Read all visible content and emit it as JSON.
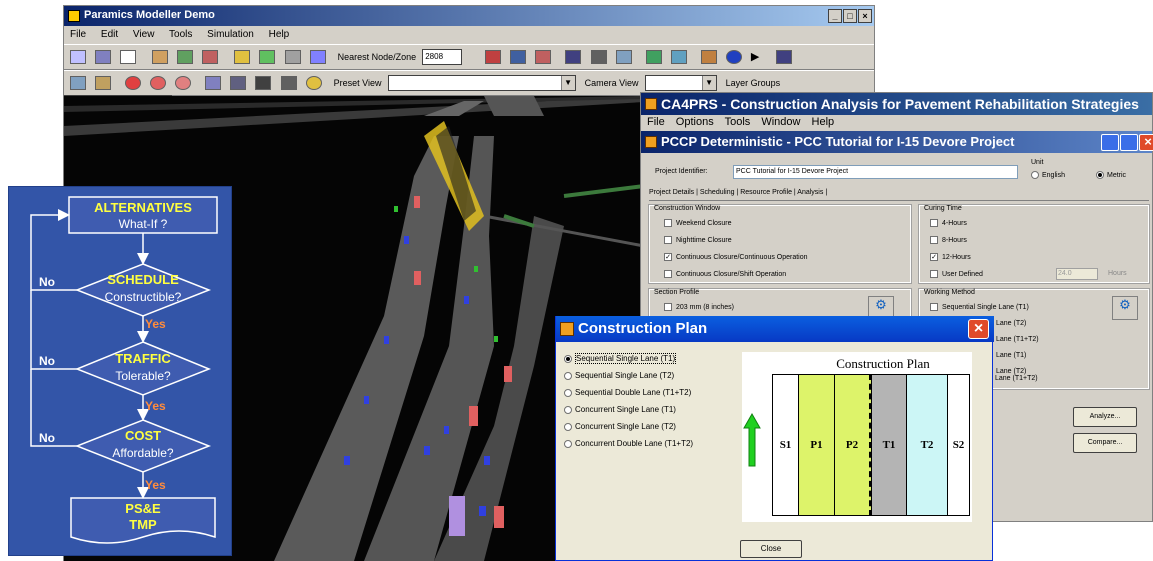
{
  "paramics": {
    "title": "Paramics Modeller Demo",
    "menu": [
      "File",
      "Edit",
      "View",
      "Tools",
      "Simulation",
      "Help"
    ],
    "toolbar": {
      "nearest_node_label": "Nearest Node/Zone",
      "nearest_node_value": "2808",
      "preset_view_label": "Preset View",
      "camera_view_label": "Camera View",
      "layer_groups_label": "Layer Groups"
    }
  },
  "flowchart": {
    "steps": [
      {
        "title": "ALTERNATIVES",
        "subtitle": "What-If ?"
      },
      {
        "title": "SCHEDULE",
        "subtitle": "Constructible?"
      },
      {
        "title": "TRAFFIC",
        "subtitle": "Tolerable?"
      },
      {
        "title": "COST",
        "subtitle": "Affordable?"
      },
      {
        "title": "PS&E",
        "subtitle": "TMP"
      }
    ],
    "no_label": "No",
    "yes_label": "Yes"
  },
  "ca4prs": {
    "title": "CA4PRS - Construction Analysis for Pavement Rehabilitation Strategies",
    "menu": [
      "File",
      "Options",
      "Tools",
      "Window",
      "Help"
    ],
    "child_title": "PCCP Deterministic - PCC Tutorial for I-15 Devore Project",
    "project_identifier_label": "Project Identifier:",
    "project_identifier_value": "PCC Tutorial for I-15 Devore Project",
    "unit_label": "Unit",
    "unit_options": [
      "English",
      "Metric"
    ],
    "unit_selected": "Metric",
    "tabs": [
      "Project Details",
      "Scheduling",
      "Resource Profile",
      "Analysis"
    ],
    "construction_window": {
      "label": "Construction Window",
      "options": [
        {
          "label": "Weekend Closure",
          "checked": false
        },
        {
          "label": "Nighttime Closure",
          "checked": false
        },
        {
          "label": "Continuous Closure/Continuous Operation",
          "checked": true
        },
        {
          "label": "Continuous Closure/Shift Operation",
          "checked": false
        }
      ]
    },
    "curing_time": {
      "label": "Curing Time",
      "options": [
        {
          "label": "4-Hours",
          "checked": false
        },
        {
          "label": "8-Hours",
          "checked": false
        },
        {
          "label": "12-Hours",
          "checked": true
        },
        {
          "label": "User Defined",
          "checked": false
        }
      ],
      "user_value": "24.0",
      "unit": "Hours"
    },
    "section_profile": {
      "label": "Section Profile",
      "option": "203 mm (8 inches)"
    },
    "working_method": {
      "label": "Working Method",
      "options": [
        "Sequential Single Lane (T1)",
        "Lane (T2)",
        "Lane (T1+T2)",
        "Lane (T1)",
        "Lane (T2)",
        "Lane (T1+T2)"
      ]
    },
    "buttons": {
      "analyze": "Analyze...",
      "compare": "Compare..."
    }
  },
  "construction_plan": {
    "title": "Construction Plan",
    "options": [
      "Sequential Single Lane (T1)",
      "Sequential Single Lane (T2)",
      "Sequential  Double Lane (T1+T2)",
      "Concurrent Single Lane (T1)",
      "Concurrent Single Lane (T2)",
      "Concurrent Double Lane (T1+T2)"
    ],
    "selected_index": 0,
    "diagram_title": "Construction Plan",
    "lanes": [
      {
        "label": "S1",
        "color": "#ffffff"
      },
      {
        "label": "P1",
        "color": "#ddf36a"
      },
      {
        "label": "P2",
        "color": "#ddf36a"
      },
      {
        "label": "T1",
        "color": "#b4b4b4"
      },
      {
        "label": "T2",
        "color": "#ccf6f6"
      },
      {
        "label": "S2",
        "color": "#ffffff"
      }
    ],
    "close_label": "Close"
  },
  "colors": {
    "flow_bg": "#3355a8",
    "flow_yellow": "#ffff40",
    "flow_yes": "#ff8c3c",
    "xp_blue": "#0a5fe0"
  }
}
